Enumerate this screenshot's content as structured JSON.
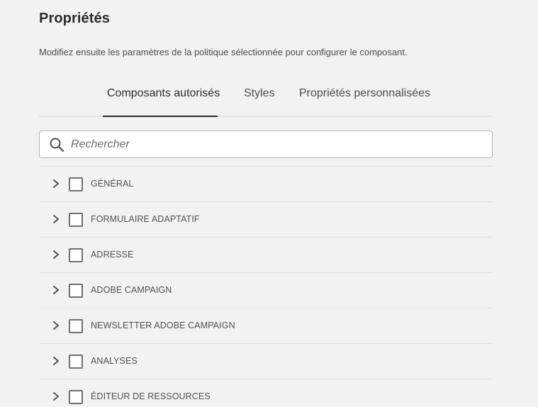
{
  "header": {
    "title": "Propriétés",
    "description": "Modifiez ensuite les paramètres de la politique sélectionnée pour configurer le composant."
  },
  "tabs": [
    {
      "label": "Composants autorisés",
      "active": true
    },
    {
      "label": "Styles",
      "active": false
    },
    {
      "label": "Propriétés personnalisées",
      "active": false
    }
  ],
  "search": {
    "placeholder": "Rechercher",
    "value": "",
    "icon": "search-icon"
  },
  "groups": [
    {
      "label": "GÉNÉRAL",
      "checked": false
    },
    {
      "label": "FORMULAIRE ADAPTATIF",
      "checked": false
    },
    {
      "label": "ADRESSE",
      "checked": false
    },
    {
      "label": "ADOBE CAMPAIGN",
      "checked": false
    },
    {
      "label": "NEWSLETTER ADOBE CAMPAIGN",
      "checked": false
    },
    {
      "label": "ANALYSES",
      "checked": false
    },
    {
      "label": "ÉDITEUR DE RESSOURCES",
      "checked": false
    }
  ],
  "colors": {
    "background": "#f2f2f2",
    "text": "#2c2c2c",
    "border": "#e1e1e1",
    "checkbox_border": "#707070"
  }
}
